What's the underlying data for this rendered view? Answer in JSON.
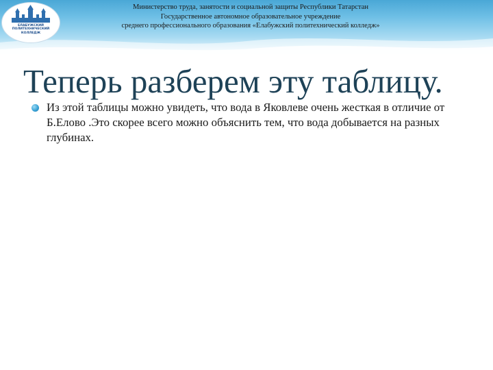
{
  "header": {
    "logo_lines": [
      "ЕЛАБУЖСКИЙ",
      "ПОЛИТЕХНИЧЕСКИЙ",
      "КОЛЛЕДЖ"
    ],
    "lines": [
      "Министерство труда, занятости и социальной защиты Республики Татарстан",
      "Государственное автономное образовательное учреждение",
      "среднего профессионального образования «Елабужский политехнический колледж»"
    ]
  },
  "slide": {
    "title": "Теперь разберем эту таблицу.",
    "bullets": [
      "Из этой таблицы можно увидеть, что вода в Яковлеве очень жесткая в отличие от Б.Елово .Это скорее всего можно объяснить тем, что вода добывается на разных глубинах."
    ]
  },
  "colors": {
    "header_blue": "#4aa7d6",
    "title": "#1e4257",
    "bullet": "#3aa3d6"
  }
}
